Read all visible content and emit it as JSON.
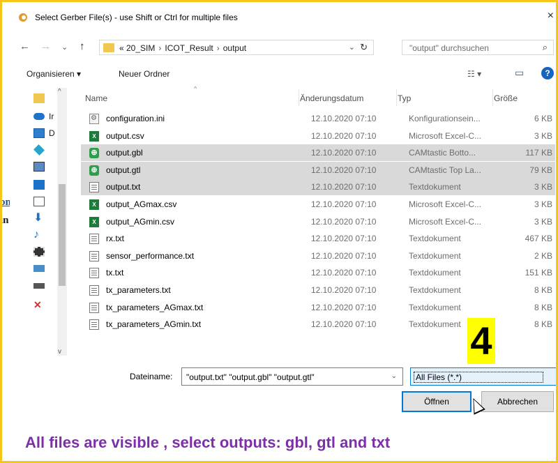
{
  "window": {
    "title": "Select Gerber File(s) - use Shift or Ctrl for multiple files",
    "close": "×"
  },
  "background": {
    "fragment_link": "on",
    "fragment_text": "in"
  },
  "nav": {
    "back": "←",
    "forward": "→",
    "recent": "⌄",
    "up": "↑",
    "breadcrumb": [
      "« 20_SIM",
      "ICOT_Result",
      "output"
    ],
    "separator": "›",
    "dropdown": "⌄",
    "refresh": "↻",
    "search_placeholder": "\"output\" durchsuchen",
    "search_icon": "⌕"
  },
  "toolbar": {
    "organize": "Organisieren ▾",
    "new_folder": "Neuer Ordner",
    "view": "☷ ▾",
    "pane": "▭",
    "help": "?"
  },
  "sidebar": {
    "items": [
      {
        "icon": "quick-access-icon",
        "label": ""
      },
      {
        "icon": "onedrive-icon",
        "label": "Ir"
      },
      {
        "icon": "this-pc-icon",
        "label": "D"
      },
      {
        "icon": "3d-objects-icon",
        "label": ""
      },
      {
        "icon": "desktop-icon",
        "label": ""
      },
      {
        "icon": "monitor-icon",
        "label": ""
      },
      {
        "icon": "documents-icon",
        "label": ""
      },
      {
        "icon": "downloads-icon",
        "label": ""
      },
      {
        "icon": "music-icon",
        "label": ""
      },
      {
        "icon": "videos-icon",
        "label": ""
      },
      {
        "icon": "network-drive-icon",
        "label": ""
      },
      {
        "icon": "drive-icon",
        "label": ""
      },
      {
        "icon": "disconnected-drive-icon",
        "label": ""
      }
    ],
    "scroll_up": "^",
    "scroll_down": "v"
  },
  "columns": {
    "name": "Name",
    "date": "Änderungsdatum",
    "type": "Typ",
    "size": "Größe",
    "sort_indicator": "^"
  },
  "files": [
    {
      "name": "configuration.ini",
      "date": "12.10.2020 07:10",
      "type": "Konfigurationsein...",
      "size": "6 KB",
      "icon": "ini",
      "selected": false
    },
    {
      "name": "output.csv",
      "date": "12.10.2020 07:10",
      "type": "Microsoft Excel-C...",
      "size": "3 KB",
      "icon": "xls",
      "selected": false
    },
    {
      "name": "output.gbl",
      "date": "12.10.2020 07:10",
      "type": "CAMtastic Botto...",
      "size": "117 KB",
      "icon": "gerber",
      "selected": true
    },
    {
      "name": "output.gtl",
      "date": "12.10.2020 07:10",
      "type": "CAMtastic Top La...",
      "size": "79 KB",
      "icon": "gerber",
      "selected": true
    },
    {
      "name": "output.txt",
      "date": "12.10.2020 07:10",
      "type": "Textdokument",
      "size": "3 KB",
      "icon": "txt",
      "selected": true
    },
    {
      "name": "output_AGmax.csv",
      "date": "12.10.2020 07:10",
      "type": "Microsoft Excel-C...",
      "size": "3 KB",
      "icon": "xls",
      "selected": false
    },
    {
      "name": "output_AGmin.csv",
      "date": "12.10.2020 07:10",
      "type": "Microsoft Excel-C...",
      "size": "3 KB",
      "icon": "xls",
      "selected": false
    },
    {
      "name": "rx.txt",
      "date": "12.10.2020 07:10",
      "type": "Textdokument",
      "size": "467 KB",
      "icon": "txt",
      "selected": false
    },
    {
      "name": "sensor_performance.txt",
      "date": "12.10.2020 07:10",
      "type": "Textdokument",
      "size": "2 KB",
      "icon": "txt",
      "selected": false
    },
    {
      "name": "tx.txt",
      "date": "12.10.2020 07:10",
      "type": "Textdokument",
      "size": "151 KB",
      "icon": "txt",
      "selected": false
    },
    {
      "name": "tx_parameters.txt",
      "date": "12.10.2020 07:10",
      "type": "Textdokument",
      "size": "8 KB",
      "icon": "txt",
      "selected": false
    },
    {
      "name": "tx_parameters_AGmax.txt",
      "date": "12.10.2020 07:10",
      "type": "Textdokument",
      "size": "8 KB",
      "icon": "txt",
      "selected": false
    },
    {
      "name": "tx_parameters_AGmin.txt",
      "date": "12.10.2020 07:10",
      "type": "Textdokument",
      "size": "8 KB",
      "icon": "txt",
      "selected": false
    }
  ],
  "footer": {
    "filename_label": "Dateiname:",
    "filename_value": "\"output.txt\" \"output.gbl\" \"output.gtl\"",
    "dropdown": "⌄",
    "filetype_value": "All Files (*.*)",
    "open_label": "Öffnen",
    "cancel_label": "Abbrechen"
  },
  "annotation": {
    "step": "4",
    "caption": "All files are visible , select outputs: gbl, gtl and txt",
    "caption_color": "#7b2fa8",
    "badge_color": "#ffff00",
    "frame_color": "#f5c518"
  }
}
